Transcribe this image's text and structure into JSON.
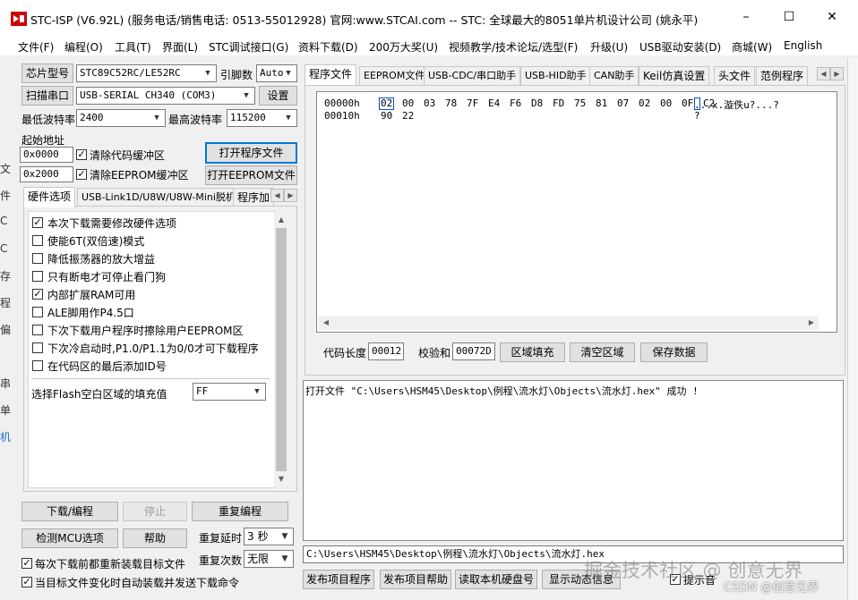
{
  "window": {
    "title": "STC-ISP (V6.92L) (服务电话/销售电话: 0513-55012928) 官网:www.STCAI.com  -- STC: 全球最大的8051单片机设计公司 (姚永平)",
    "controls": {
      "minimize": "–",
      "maximize": "☐",
      "close": "✕"
    }
  },
  "menu": [
    "文件(F)",
    "编程(O)",
    "工具(T)",
    "界面(L)",
    "STC调试接口(G)",
    "资料下载(D)",
    "200万大奖(U)",
    "视频教学/技术论坛/选型(F)",
    "升级(U)",
    "USB驱动安装(D)",
    "商城(W)",
    "English"
  ],
  "left": {
    "chip_label": "芯片型号",
    "chip_value": "STC89C52RC/LE52RC",
    "pins_label": "引脚数",
    "pins_value": "Auto",
    "scan_port_button": "扫描串口",
    "port_value": "USB-SERIAL CH340 (COM3)",
    "settings_button": "设置",
    "min_baud_label": "最低波特率",
    "min_baud_value": "2400",
    "max_baud_label": "最高波特率",
    "max_baud_value": "115200",
    "start_addr_label": "起始地址",
    "addr1": "0x0000",
    "addr2": "0x2000",
    "clear_code_label": "清除代码缓冲区",
    "clear_eeprom_label": "清除EEPROM缓冲区",
    "open_prog_button": "打开程序文件",
    "open_eeprom_button": "打开EEPROM文件",
    "tabs": [
      "硬件选项",
      "USB-Link1D/U8W/U8W-Mini脱机",
      "程序加"
    ],
    "options": [
      {
        "label": "本次下载需要修改硬件选项",
        "checked": true
      },
      {
        "label": "使能6T(双倍速)模式",
        "checked": false
      },
      {
        "label": "降低振荡器的放大增益",
        "checked": false
      },
      {
        "label": "只有断电才可停止看门狗",
        "checked": false
      },
      {
        "label": "内部扩展RAM可用",
        "checked": true
      },
      {
        "label": "ALE脚用作P4.5口",
        "checked": false
      },
      {
        "label": "下次下载用户程序时擦除用户EEPROM区",
        "checked": false
      },
      {
        "label": "下次冷启动时,P1.0/P1.1为0/0才可下载程序",
        "checked": false
      },
      {
        "label": "在代码区的最后添加ID号",
        "checked": false
      }
    ],
    "fill_label": "选择Flash空白区域的填充值",
    "fill_value": "FF",
    "download_button": "下载/编程",
    "stop_button": "停止",
    "reprogram_button": "重复编程",
    "detect_button": "检测MCU选项",
    "help_button": "帮助",
    "repeat_delay_label": "重复延时",
    "repeat_delay_value": "3 秒",
    "repeat_count_label": "重复次数",
    "repeat_count_value": "无限",
    "reload_label": "每次下载前都重新装载目标文件",
    "auto_label": "当目标文件变化时自动装载并发送下载命令"
  },
  "right": {
    "tabs": [
      "程序文件",
      "EEPROM文件",
      "USB-CDC/串口助手",
      "USB-HID助手",
      "CAN助手",
      "Keil仿真设置",
      "头文件",
      "范例程序"
    ],
    "hex_rows": [
      {
        "addr": "00000h",
        "bytes": [
          "02",
          "00",
          "03",
          "78",
          "7F",
          "E4",
          "F6",
          "D8",
          "FD",
          "75",
          "81",
          "07",
          "02",
          "00",
          "0F",
          "C2"
        ],
        "ascii": "...x.漩佚u?...?"
      },
      {
        "addr": "00010h",
        "bytes": [
          "90",
          "22"
        ],
        "ascii": "?"
      }
    ],
    "code_len_label": "代码长度",
    "code_len_value": "00012",
    "checksum_label": "校验和",
    "checksum_value": "00072D",
    "fill_region_button": "区域填充",
    "clear_region_button": "清空区域",
    "save_data_button": "保存数据",
    "log": "打开文件 \"C:\\Users\\HSM45\\Desktop\\例程\\流水灯\\Objects\\流水灯.hex\" 成功 !",
    "path": "C:\\Users\\HSM45\\Desktop\\例程\\流水灯\\Objects\\流水灯.hex",
    "bottom_buttons": [
      "发布项目程序",
      "发布项目帮助",
      "读取本机硬盘号",
      "显示动态信息"
    ],
    "beep_label": "提示音",
    "watermark": "掘金技术社区 @ 创意无界",
    "csdn": "CSDN @创意无界"
  },
  "edge_text": [
    "文",
    "件",
    "C",
    "C",
    "存",
    "程",
    "偏",
    "串",
    "单",
    "机"
  ]
}
